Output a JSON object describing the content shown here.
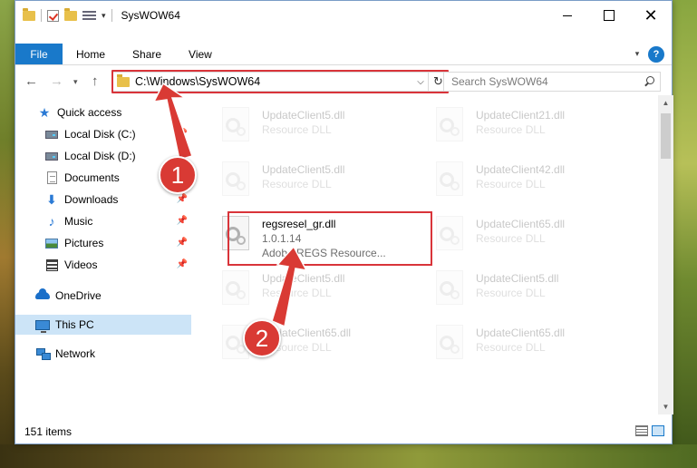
{
  "titlebar": {
    "title": "SysWOW64",
    "min_label": "",
    "max_label": "",
    "close_label": "✕"
  },
  "ribbon": {
    "tabs": [
      "File",
      "Home",
      "Share",
      "View"
    ],
    "help": "?"
  },
  "address": {
    "path": "C:\\Windows\\SysWOW64",
    "search_placeholder": "Search SysWOW64"
  },
  "nav": {
    "items": [
      {
        "label": "Quick access",
        "icon": "star-icon"
      },
      {
        "label": "Local Disk (C:)",
        "icon": "drive-icon",
        "pinned": true
      },
      {
        "label": "Local Disk (D:)",
        "icon": "drive-icon",
        "pinned": true
      },
      {
        "label": "Documents",
        "icon": "document-icon",
        "pinned": true
      },
      {
        "label": "Downloads",
        "icon": "download-icon",
        "pinned": true
      },
      {
        "label": "Music",
        "icon": "music-icon",
        "pinned": true
      },
      {
        "label": "Pictures",
        "icon": "pictures-icon",
        "pinned": true
      },
      {
        "label": "Videos",
        "icon": "videos-icon",
        "pinned": true
      },
      {
        "label": "OneDrive",
        "icon": "onedrive-icon"
      },
      {
        "label": "This PC",
        "icon": "this-pc-icon",
        "selected": true
      },
      {
        "label": "Network",
        "icon": "network-icon"
      }
    ]
  },
  "files": [
    {
      "name": "UpdateClient5.dll",
      "sub": "Resource DLL",
      "sub2": ""
    },
    {
      "name": "UpdateClient21.dll",
      "sub": "Resource DLL",
      "sub2": ""
    },
    {
      "name": "UpdateClient5.dll",
      "sub": "Resource DLL",
      "sub2": ""
    },
    {
      "name": "UpdateClient42.dll",
      "sub": "Resource DLL",
      "sub2": ""
    },
    {
      "name": "regsresel_gr.dll",
      "sub": "1.0.1.14",
      "sub2": "Adobe REGS Resource..."
    },
    {
      "name": "UpdateClient65.dll",
      "sub": "Resource DLL",
      "sub2": ""
    },
    {
      "name": "UpdateClient5.dll",
      "sub": "Resource DLL",
      "sub2": ""
    },
    {
      "name": "UpdateClient5.dll",
      "sub": "Resource DLL",
      "sub2": ""
    },
    {
      "name": "UpdateClient65.dll",
      "sub": "Resource DLL",
      "sub2": ""
    },
    {
      "name": "UpdateClient65.dll",
      "sub": "Resource DLL",
      "sub2": ""
    }
  ],
  "status": {
    "count": "151 items"
  },
  "annotations": {
    "step1": "1",
    "step2": "2"
  },
  "colors": {
    "accent": "#1979ca",
    "highlight": "#d9343a",
    "selection": "#cce4f7"
  }
}
